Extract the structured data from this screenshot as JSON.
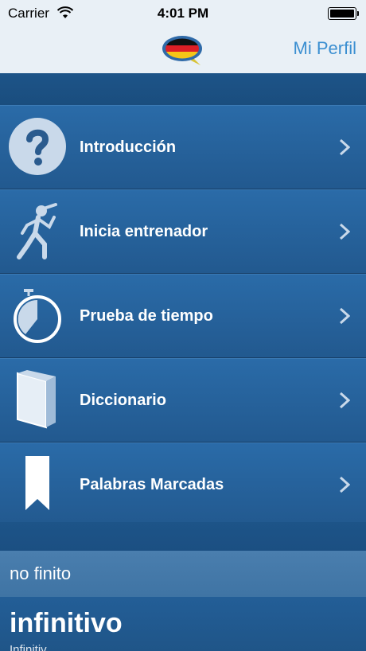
{
  "status_bar": {
    "carrier": "Carrier",
    "time": "4:01 PM"
  },
  "nav": {
    "logo_icon": "german-flag-speech-bubble-icon",
    "profile_label": "Mi Perfil"
  },
  "menu": {
    "items": [
      {
        "label": "Introducción",
        "icon": "question-mark-icon"
      },
      {
        "label": "Inicia entrenador",
        "icon": "runner-icon"
      },
      {
        "label": "Prueba de tiempo",
        "icon": "stopwatch-icon"
      },
      {
        "label": "Diccionario",
        "icon": "book-icon"
      },
      {
        "label": "Palabras Marcadas",
        "icon": "bookmark-icon"
      }
    ]
  },
  "word": {
    "type": "no finito",
    "main": "infinitivo",
    "sub": "Infinitiv"
  },
  "colors": {
    "accent": "#3b8fd1",
    "list_background": "#22598f"
  }
}
